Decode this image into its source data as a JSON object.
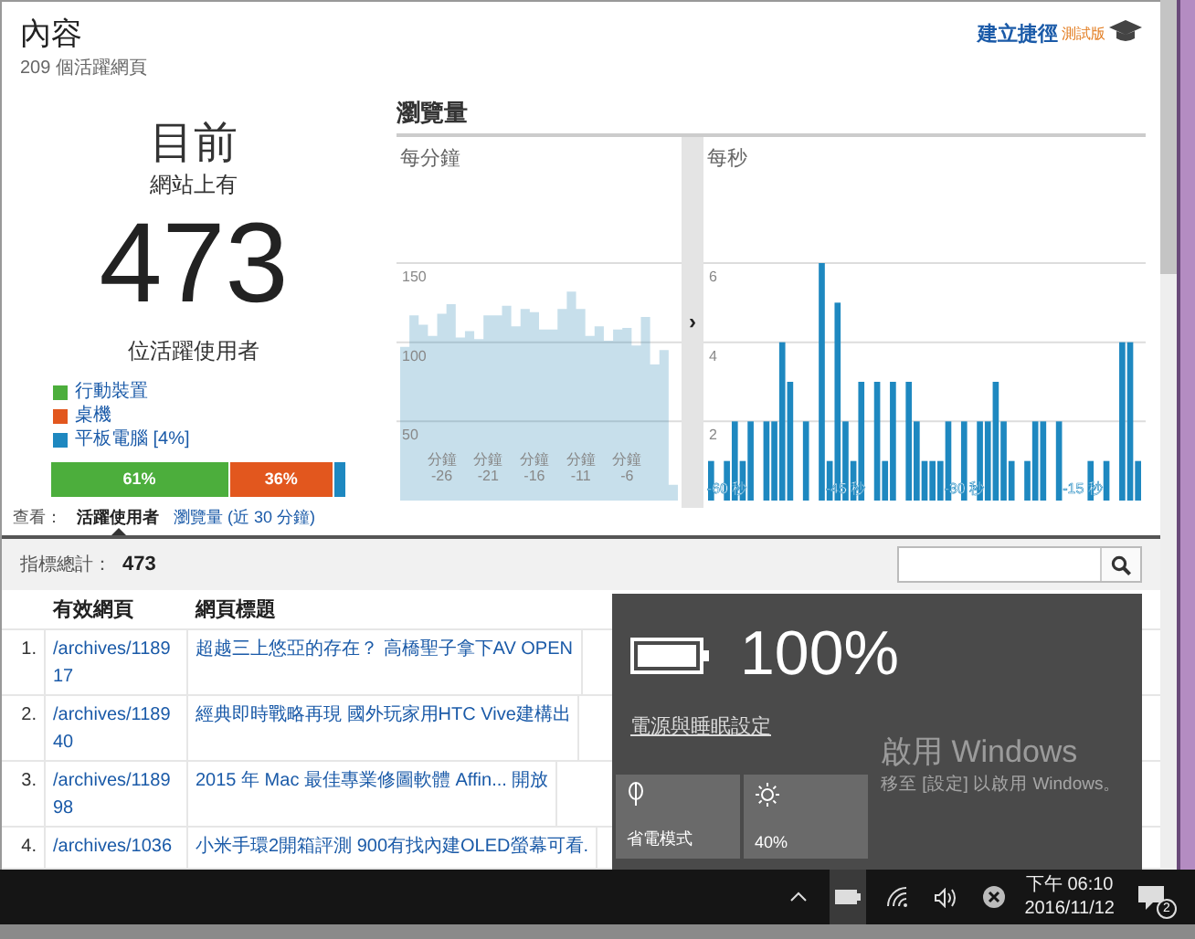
{
  "header": {
    "title": "內容",
    "subtitle": "209 個活躍網頁",
    "shortcut_link": "建立捷徑",
    "beta_badge": "測試版"
  },
  "summary": {
    "heading": "目前",
    "caption": "網站上有",
    "count": "473",
    "unit": "位活躍使用者",
    "devices": [
      {
        "label": "行動裝置",
        "color": "#4cae3c",
        "level": 0.61,
        "reading": "61%"
      },
      {
        "label": "桌機",
        "color": "#e2571e",
        "level": 0.36,
        "reading": "36%"
      },
      {
        "label": "平板電腦 [4%]",
        "color": "#1e88c0",
        "level": 0.04
      }
    ]
  },
  "view_tabs": {
    "label": "查看：",
    "tabs": [
      {
        "label": "活躍使用者",
        "selected": true
      },
      {
        "label": "瀏覽量 (近 30 分鐘)",
        "selected": false
      }
    ]
  },
  "pageviews": {
    "title": "瀏覽量",
    "expand_arrow": "›",
    "per_minute": {
      "chart_data": {
        "type": "area",
        "title": "每分鐘",
        "x": [
          -30,
          -29,
          -28,
          -27,
          -26,
          -25,
          -24,
          -23,
          -22,
          -21,
          -20,
          -19,
          -18,
          -17,
          -16,
          -15,
          -14,
          -13,
          -12,
          -11,
          -10,
          -9,
          -8,
          -7,
          -6,
          -5,
          -4,
          -3,
          -2,
          -1
        ],
        "series": [
          {
            "color": "#1e7fb0",
            "values": [
              97,
              117,
              111,
              104,
              118,
              124,
              103,
              107,
              102,
              117,
              117,
              123,
              110,
              121,
              119,
              108,
              108,
              121,
              132,
              121,
              104,
              110,
              101,
              108,
              109,
              98,
              116,
              86,
              95,
              10
            ]
          }
        ],
        "xlim": [
          -30.5,
          -0.5
        ],
        "ylim": [
          0,
          150
        ],
        "yticks": [
          50,
          100,
          150
        ],
        "grid": true,
        "xticks": [
          {
            "value": -26,
            "label": "分鐘 -26"
          },
          {
            "value": -21,
            "label": "分鐘 -21"
          },
          {
            "value": -16,
            "label": "分鐘 -16"
          },
          {
            "value": -11,
            "label": "分鐘 -11"
          },
          {
            "value": -6,
            "label": "分鐘 -6"
          }
        ]
      }
    },
    "per_second": {
      "chart_data": {
        "type": "bar",
        "title": "每秒",
        "x": [
          -62,
          -61,
          -60,
          -59,
          -58,
          -57,
          -56,
          -55,
          -54,
          -53,
          -52,
          -51,
          -50,
          -49,
          -48,
          -47,
          -46,
          -45,
          -44,
          -43,
          -42,
          -41,
          -40,
          -39,
          -38,
          -37,
          -36,
          -35,
          -34,
          -33,
          -32,
          -31,
          -30,
          -29,
          -28,
          -27,
          -26,
          -25,
          -24,
          -23,
          -22,
          -21,
          -20,
          -19,
          -18,
          -17,
          -16,
          -15,
          -14,
          -13,
          -12,
          -11,
          -10,
          -9,
          -8
        ],
        "series": [
          {
            "color": "#1e88c0",
            "values": [
              1,
              0,
              1,
              2,
              1,
              2,
              0,
              2,
              2,
              4,
              3,
              0,
              2,
              0,
              6,
              1,
              5,
              2,
              1,
              3,
              0,
              3,
              1,
              3,
              0,
              3,
              2,
              1,
              1,
              1,
              2,
              0,
              2,
              0,
              2,
              2,
              3,
              2,
              1,
              0,
              1,
              2,
              2,
              0,
              2,
              0,
              0,
              0,
              1,
              0,
              1,
              0,
              4,
              4,
              1
            ]
          }
        ],
        "xlim": [
          -62.5,
          -7.5
        ],
        "ylim": [
          0,
          6
        ],
        "yticks": [
          2,
          4,
          6
        ],
        "grid": true,
        "xticks": [
          {
            "value": -60,
            "label": "-60 秒"
          },
          {
            "value": -45,
            "label": "-45 秒"
          },
          {
            "value": -30,
            "label": "-30 秒"
          },
          {
            "value": -15,
            "label": "-15 秒"
          }
        ]
      }
    }
  },
  "metrics_bar": {
    "label": "指標總計：",
    "total": "473"
  },
  "table": {
    "columns": [
      "有效網頁",
      "網頁標題"
    ],
    "rows": [
      {
        "index": "1.",
        "page": "/archives/118917",
        "title": "超越三上悠亞的存在？ 高橋聖子拿下AV OPEN"
      },
      {
        "index": "2.",
        "page": "/archives/118940",
        "title": "經典即時戰略再現 國外玩家用HTC Vive建構出"
      },
      {
        "index": "3.",
        "page": "/archives/118998",
        "title": "2015 年 Mac 最佳專業修圖軟體 Affin... 開放"
      },
      {
        "index": "4.",
        "page": "/archives/1036",
        "title": "小米手環2開箱評測 900有找內建OLED螢幕可看."
      }
    ]
  },
  "battery_flyout": {
    "percent": "100%",
    "settings_link": "電源與睡眠設定",
    "tiles": [
      {
        "kind": "saver",
        "label": "省電模式",
        "on": false
      },
      {
        "kind": "brightness",
        "label": "40%",
        "on": false
      }
    ]
  },
  "activation_notice": {
    "title": "啟用 Windows",
    "text": "移至 [設定] 以啟用 Windows。"
  },
  "taskbar": {
    "time": "下午 06:10",
    "date": "2016/11/12",
    "notifications": "2"
  }
}
